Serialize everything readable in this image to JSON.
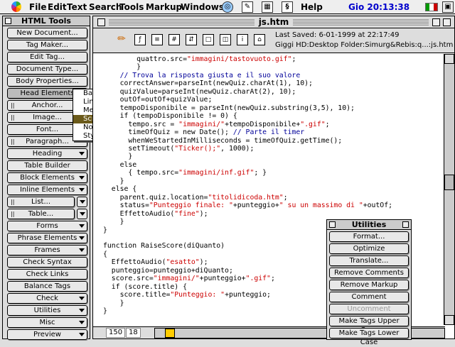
{
  "menubar": {
    "items": [
      "File",
      "Edit",
      "Text",
      "Search",
      "Tools",
      "Markup",
      "Windows",
      "Help"
    ],
    "clock": "Gio 20:13:38"
  },
  "palette": {
    "title": "HTML Tools",
    "buttons": [
      {
        "label": "New Document..."
      },
      {
        "label": "Tag Maker..."
      },
      {
        "label": "Edit Tag..."
      },
      {
        "label": "Document Type..."
      },
      {
        "label": "Body Properties..."
      },
      {
        "label": "Head Elements"
      },
      {
        "label": "Anchor..."
      },
      {
        "label": "Image..."
      },
      {
        "label": "Font..."
      },
      {
        "label": "Paragraph..."
      },
      {
        "label": "Heading"
      },
      {
        "label": "Table Builder"
      },
      {
        "label": "Block Elements"
      },
      {
        "label": "Inline Elements"
      },
      {
        "label": "List..."
      },
      {
        "label": "Table..."
      },
      {
        "label": "Forms"
      },
      {
        "label": "Phrase Elements"
      },
      {
        "label": "Frames"
      },
      {
        "label": "Check Syntax"
      },
      {
        "label": "Check Links"
      },
      {
        "label": "Balance Tags"
      },
      {
        "label": "Check"
      },
      {
        "label": "Utilities"
      },
      {
        "label": "Misc"
      },
      {
        "label": "Preview"
      }
    ]
  },
  "popup": {
    "items": [
      "Base...",
      "Link...",
      "Meta...",
      "Script...",
      "Noscript",
      "Style..."
    ],
    "highlighted": "Script..."
  },
  "window": {
    "title": "js.htm",
    "last_saved": "Last Saved: 6-01-1999 at 22:17:49",
    "path": "Giggi HD:Desktop Folder:Simurg&Rebis:q...:js.htm",
    "status_line": "150",
    "status_col": "18"
  },
  "code_lines": [
    "        quattro.src=\"immagini/tastovuoto.gif\";",
    "        }",
    "    // Trova la risposta giusta e il suo valore",
    "    correctAnswer=parseInt(newQuiz.charAt(1), 10);",
    "    quizValue=parseInt(newQuiz.charAt(2), 10);",
    "    outOf=outOf+quizValue;",
    "    tempoDisponibile = parseInt(newQuiz.substring(3,5), 10);",
    "    if (tempoDisponibile != 0) {",
    "      tempo.src = \"immagini/\"+tempoDisponibile+\".gif\";",
    "      timeOfQuiz = new Date(); // Parte il timer",
    "      whenWeStartedInMilliseconds = timeOfQuiz.getTime();",
    "      setTimeout(\"Ticker();\", 1000);",
    "      }",
    "    else",
    "      { tempo.src=\"immagini/inf.gif\"; }",
    "    }",
    "  else {",
    "    parent.quiz.location=\"titolidicoda.htm\";",
    "    status=\"Punteggio finale: \"+punteggio+\" su un massimo di \"+outOf;",
    "    EffettoAudio(\"fine\");",
    "    }",
    "}",
    "",
    "function RaiseScore(diQuanto)",
    "{",
    "  EffettoAudio(\"esatto\");",
    "  punteggio=punteggio+diQuanto;",
    "  score.src=\"immagini/\"+punteggio+\".gif\";",
    "  if (score.title) {",
    "    score.title=\"Punteggio: \"+punteggio;",
    "    }",
    "}"
  ],
  "utilities": {
    "title": "Utilities",
    "buttons": [
      {
        "label": "Format...",
        "enabled": true
      },
      {
        "label": "Optimize",
        "enabled": true
      },
      {
        "label": "Translate...",
        "enabled": true
      },
      {
        "label": "Remove Comments",
        "enabled": true
      },
      {
        "label": "Remove Markup",
        "enabled": true
      },
      {
        "label": "Comment",
        "enabled": true
      },
      {
        "label": "Uncomment",
        "enabled": false
      },
      {
        "label": "Make Tags Upper Case",
        "enabled": true
      },
      {
        "label": "Make Tags Lower Case",
        "enabled": true
      }
    ]
  },
  "colors": {
    "string": "#cc0000",
    "comment": "#000099",
    "popup_highlight": "#6b5a1a"
  }
}
